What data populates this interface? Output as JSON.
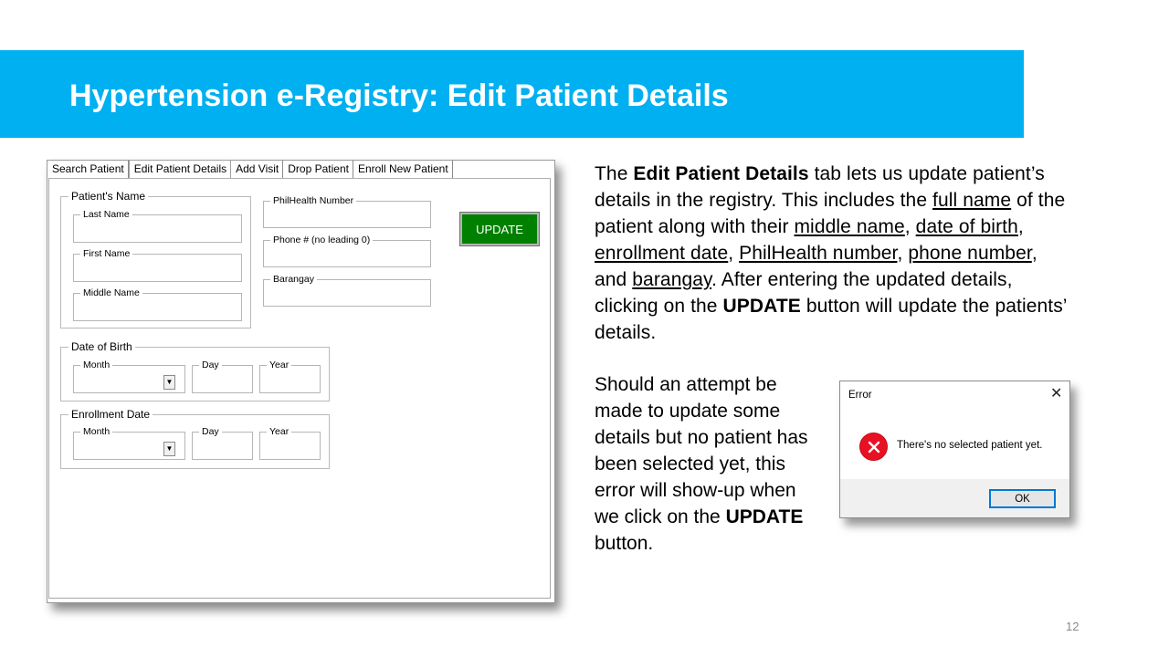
{
  "slide": {
    "title": "Hypertension e-Registry: Edit Patient Details",
    "page_number": "12",
    "banner_color": "#00b0f0"
  },
  "form": {
    "tabs": [
      {
        "label": "Search Patient",
        "active": false
      },
      {
        "label": "Edit Patient Details",
        "active": true
      },
      {
        "label": "Add Visit",
        "active": false
      },
      {
        "label": "Drop Patient",
        "active": false
      },
      {
        "label": "Enroll New Patient",
        "active": false
      }
    ],
    "patient_name": {
      "legend": "Patient's Name",
      "last_name": "Last Name",
      "first_name": "First Name",
      "middle_name": "Middle Name"
    },
    "philhealth_label": "PhilHealth Number",
    "phone_label": "Phone # (no leading 0)",
    "barangay_label": "Barangay",
    "update_button": "UPDATE",
    "update_button_color": "#008000",
    "dob": {
      "legend": "Date of Birth",
      "month": "Month",
      "day": "Day",
      "year": "Year"
    },
    "enrollment": {
      "legend": "Enrollment Date",
      "month": "Month",
      "day": "Day",
      "year": "Year"
    }
  },
  "description": {
    "p1": [
      {
        "text": "The ",
        "style": "normal"
      },
      {
        "text": "Edit Patient Details",
        "style": "bold"
      },
      {
        "text": " tab lets us update patient’s details in the registry. This includes the ",
        "style": "normal"
      },
      {
        "text": "full name",
        "style": "underline"
      },
      {
        "text": " of the patient along with their ",
        "style": "normal"
      },
      {
        "text": "middle name",
        "style": "underline"
      },
      {
        "text": ", ",
        "style": "normal"
      },
      {
        "text": "date of birth",
        "style": "underline"
      },
      {
        "text": ", ",
        "style": "normal"
      },
      {
        "text": "enrollment date",
        "style": "underline"
      },
      {
        "text": ", ",
        "style": "normal"
      },
      {
        "text": "PhilHealth number",
        "style": "underline"
      },
      {
        "text": ", ",
        "style": "normal"
      },
      {
        "text": "phone number",
        "style": "underline"
      },
      {
        "text": ", and ",
        "style": "normal"
      },
      {
        "text": "barangay",
        "style": "underline"
      },
      {
        "text": ". After entering the updated details, clicking on the ",
        "style": "normal"
      },
      {
        "text": "UPDATE",
        "style": "bold"
      },
      {
        "text": " button will update the patients’ details.",
        "style": "normal"
      }
    ],
    "p2": [
      {
        "text": "Should an attempt be made to update some details but no patient has been selected yet, this error will show-up when we click on the ",
        "style": "normal"
      },
      {
        "text": "UPDATE",
        "style": "bold"
      },
      {
        "text": " button.",
        "style": "normal"
      }
    ]
  },
  "error_dialog": {
    "title": "Error",
    "message": "There's no selected patient yet.",
    "ok_label": "OK",
    "icon": "error-icon",
    "icon_color": "#e81123"
  }
}
